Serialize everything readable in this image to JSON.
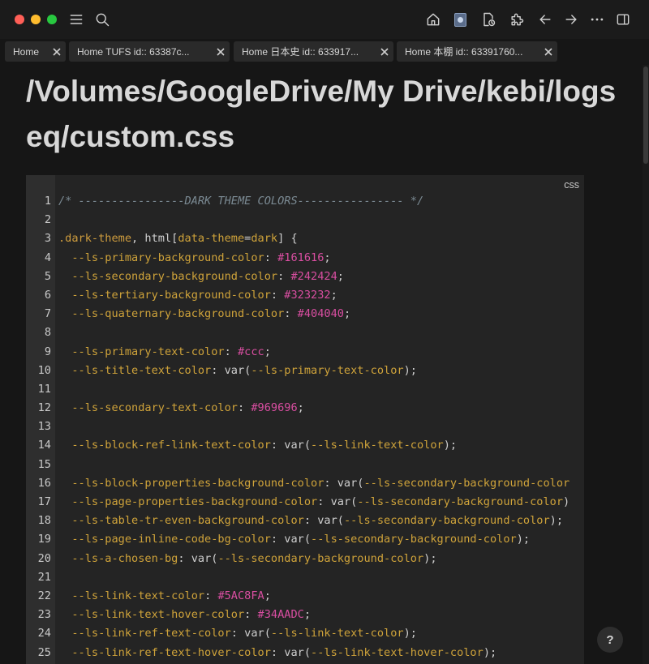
{
  "toolbar": {
    "icons": [
      "menu-icon",
      "search-icon",
      "home-icon",
      "avatar-icon",
      "page-clock-icon",
      "puzzle-icon",
      "arrow-left-icon",
      "arrow-right-icon",
      "more-icon",
      "sidebar-toggle-icon"
    ]
  },
  "tabs": [
    {
      "label": "Home"
    },
    {
      "label": "Home  TUFS id:: 63387c..."
    },
    {
      "label": "Home  日本史 id:: 633917..."
    },
    {
      "label": "Home  本棚 id:: 63391760..."
    }
  ],
  "page": {
    "title": "/Volumes/GoogleDrive/My Drive/kebi/logseq/custom.css"
  },
  "code_block": {
    "language": "css",
    "lines": [
      {
        "n": "1",
        "t": [
          [
            "comment",
            "/* ----------------DARK THEME COLORS---------------- */"
          ]
        ]
      },
      {
        "n": "2",
        "t": []
      },
      {
        "n": "3",
        "t": [
          [
            "selector",
            ".dark-theme"
          ],
          [
            "plain",
            ", html["
          ],
          [
            "prop",
            "data-theme"
          ],
          [
            "plain",
            "="
          ],
          [
            "prop",
            "dark"
          ],
          [
            "plain",
            "] {"
          ]
        ]
      },
      {
        "n": "4",
        "t": [
          [
            "plain",
            "  "
          ],
          [
            "prop",
            "--ls-primary-background-color"
          ],
          [
            "plain",
            ": "
          ],
          [
            "hex",
            "#161616"
          ],
          [
            "plain",
            ";"
          ]
        ]
      },
      {
        "n": "5",
        "t": [
          [
            "plain",
            "  "
          ],
          [
            "prop",
            "--ls-secondary-background-color"
          ],
          [
            "plain",
            ": "
          ],
          [
            "hex",
            "#242424"
          ],
          [
            "plain",
            ";"
          ]
        ]
      },
      {
        "n": "6",
        "t": [
          [
            "plain",
            "  "
          ],
          [
            "prop",
            "--ls-tertiary-background-color"
          ],
          [
            "plain",
            ": "
          ],
          [
            "hex",
            "#323232"
          ],
          [
            "plain",
            ";"
          ]
        ]
      },
      {
        "n": "7",
        "t": [
          [
            "plain",
            "  "
          ],
          [
            "prop",
            "--ls-quaternary-background-color"
          ],
          [
            "plain",
            ": "
          ],
          [
            "hex",
            "#404040"
          ],
          [
            "plain",
            ";"
          ]
        ]
      },
      {
        "n": "8",
        "t": []
      },
      {
        "n": "9",
        "t": [
          [
            "plain",
            "  "
          ],
          [
            "prop",
            "--ls-primary-text-color"
          ],
          [
            "plain",
            ": "
          ],
          [
            "hex",
            "#ccc"
          ],
          [
            "plain",
            ";"
          ]
        ]
      },
      {
        "n": "10",
        "t": [
          [
            "plain",
            "  "
          ],
          [
            "prop",
            "--ls-title-text-color"
          ],
          [
            "plain",
            ": var("
          ],
          [
            "var",
            "--ls-primary-text-color"
          ],
          [
            "plain",
            ");"
          ]
        ]
      },
      {
        "n": "11",
        "t": []
      },
      {
        "n": "12",
        "t": [
          [
            "plain",
            "  "
          ],
          [
            "prop",
            "--ls-secondary-text-color"
          ],
          [
            "plain",
            ": "
          ],
          [
            "hex",
            "#969696"
          ],
          [
            "plain",
            ";"
          ]
        ]
      },
      {
        "n": "13",
        "t": []
      },
      {
        "n": "14",
        "t": [
          [
            "plain",
            "  "
          ],
          [
            "prop",
            "--ls-block-ref-link-text-color"
          ],
          [
            "plain",
            ": var("
          ],
          [
            "var",
            "--ls-link-text-color"
          ],
          [
            "plain",
            ");"
          ]
        ]
      },
      {
        "n": "15",
        "t": []
      },
      {
        "n": "16",
        "t": [
          [
            "plain",
            "  "
          ],
          [
            "prop",
            "--ls-block-properties-background-color"
          ],
          [
            "plain",
            ": var("
          ],
          [
            "var",
            "--ls-secondary-background-color"
          ]
        ]
      },
      {
        "n": "17",
        "t": [
          [
            "plain",
            "  "
          ],
          [
            "prop",
            "--ls-page-properties-background-color"
          ],
          [
            "plain",
            ": var("
          ],
          [
            "var",
            "--ls-secondary-background-color"
          ],
          [
            "plain",
            ")"
          ]
        ]
      },
      {
        "n": "18",
        "t": [
          [
            "plain",
            "  "
          ],
          [
            "prop",
            "--ls-table-tr-even-background-color"
          ],
          [
            "plain",
            ": var("
          ],
          [
            "var",
            "--ls-secondary-background-color"
          ],
          [
            "plain",
            ");"
          ]
        ]
      },
      {
        "n": "19",
        "t": [
          [
            "plain",
            "  "
          ],
          [
            "prop",
            "--ls-page-inline-code-bg-color"
          ],
          [
            "plain",
            ": var("
          ],
          [
            "var",
            "--ls-secondary-background-color"
          ],
          [
            "plain",
            ");"
          ]
        ]
      },
      {
        "n": "20",
        "t": [
          [
            "plain",
            "  "
          ],
          [
            "prop",
            "--ls-a-chosen-bg"
          ],
          [
            "plain",
            ": var("
          ],
          [
            "var",
            "--ls-secondary-background-color"
          ],
          [
            "plain",
            ");"
          ]
        ]
      },
      {
        "n": "21",
        "t": []
      },
      {
        "n": "22",
        "t": [
          [
            "plain",
            "  "
          ],
          [
            "prop",
            "--ls-link-text-color"
          ],
          [
            "plain",
            ": "
          ],
          [
            "hex",
            "#5AC8FA"
          ],
          [
            "plain",
            ";"
          ]
        ]
      },
      {
        "n": "23",
        "t": [
          [
            "plain",
            "  "
          ],
          [
            "prop",
            "--ls-link-text-hover-color"
          ],
          [
            "plain",
            ": "
          ],
          [
            "hex",
            "#34AADC"
          ],
          [
            "plain",
            ";"
          ]
        ]
      },
      {
        "n": "24",
        "t": [
          [
            "plain",
            "  "
          ],
          [
            "prop",
            "--ls-link-ref-text-color"
          ],
          [
            "plain",
            ": var("
          ],
          [
            "var",
            "--ls-link-text-color"
          ],
          [
            "plain",
            ");"
          ]
        ]
      },
      {
        "n": "25",
        "t": [
          [
            "plain",
            "  "
          ],
          [
            "prop",
            "--ls-link-ref-text-hover-color"
          ],
          [
            "plain",
            ": var("
          ],
          [
            "var",
            "--ls-link-text-hover-color"
          ],
          [
            "plain",
            ");"
          ]
        ]
      }
    ]
  },
  "help": {
    "label": "?"
  },
  "colors": {
    "background": "#161616",
    "code_background": "#242424",
    "hex_token": "#d94ea1",
    "property_token": "#cfa33a",
    "comment_token": "#7b8a93"
  }
}
